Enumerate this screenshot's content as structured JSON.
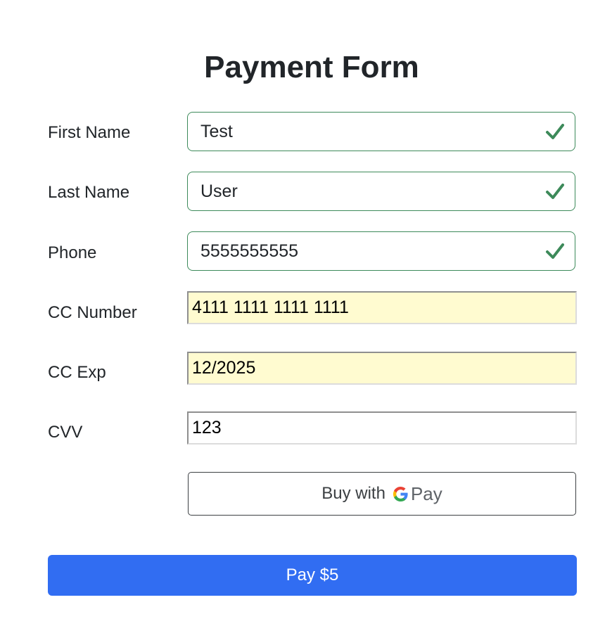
{
  "form": {
    "title": "Payment Form",
    "fields": {
      "first_name": {
        "label": "First Name",
        "value": "Test"
      },
      "last_name": {
        "label": "Last Name",
        "value": "User"
      },
      "phone": {
        "label": "Phone",
        "value": "5555555555"
      },
      "cc_number": {
        "label": "CC Number",
        "value": "4111 1111 1111 1111"
      },
      "cc_exp": {
        "label": "CC Exp",
        "value": "12/2025"
      },
      "cvv": {
        "label": "CVV",
        "value": "123"
      }
    },
    "gpay_button": {
      "prefix": "Buy with",
      "brand": "Pay",
      "icon": "google-g-icon"
    },
    "pay_button": {
      "label": "Pay $5"
    }
  },
  "colors": {
    "valid_border": "#3d8a5a",
    "valid_check": "#3d8a5a",
    "autofill_background": "#fffbd0",
    "pay_button": "#316df2"
  }
}
